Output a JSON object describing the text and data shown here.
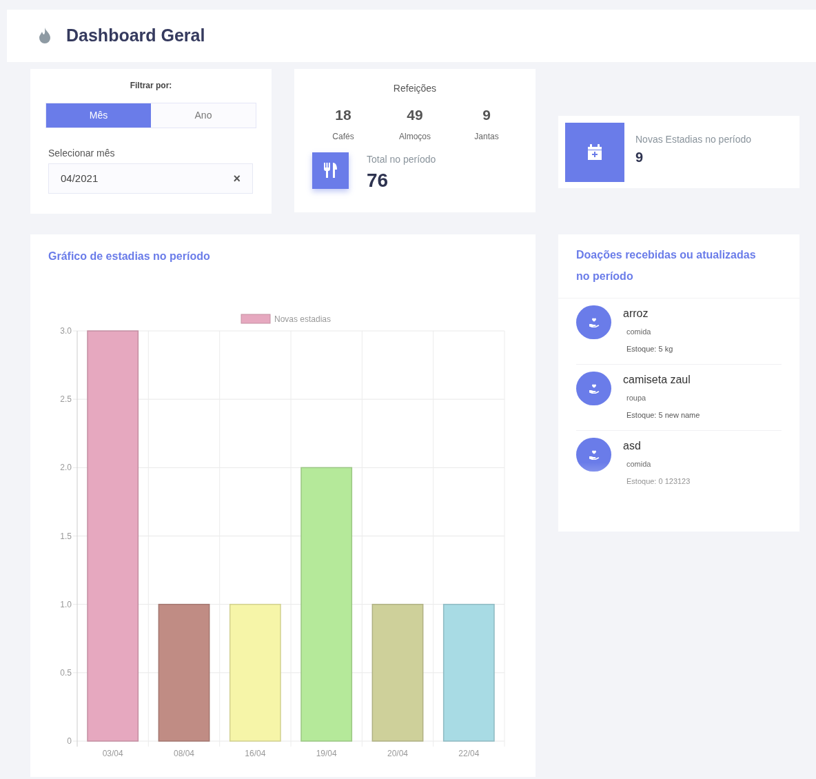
{
  "header": {
    "title": "Dashboard Geral"
  },
  "filter": {
    "label": "Filtrar por:",
    "options": [
      {
        "label": "Mês",
        "selected": true
      },
      {
        "label": "Ano",
        "selected": false
      }
    ],
    "month_label": "Selecionar mês",
    "month_value": "04/2021",
    "clear": "×"
  },
  "meals": {
    "title": "Refeições",
    "counts": [
      {
        "value": "18",
        "label": "Cafés"
      },
      {
        "value": "49",
        "label": "Almoços"
      },
      {
        "value": "9",
        "label": "Jantas"
      }
    ],
    "total_label": "Total no período",
    "total": "76"
  },
  "stays": {
    "label": "Novas Estadias no período",
    "value": "9"
  },
  "chart": {
    "title": "Gráfico de estadias no período",
    "chart_data": {
      "type": "bar",
      "categories": [
        "03/04",
        "08/04",
        "16/04",
        "19/04",
        "20/04",
        "22/04"
      ],
      "series": [
        {
          "name": "Novas estadias",
          "color": [
            "#e6a8bf",
            "#c08c84",
            "#f6f5a8",
            "#b5e99a",
            "#ced09a",
            "#a8dbe4"
          ],
          "values": [
            3,
            1,
            1,
            2,
            1,
            1
          ]
        }
      ],
      "ylim": [
        0,
        3
      ],
      "yticks": [
        {
          "value": 0,
          "label": "0"
        },
        0.5,
        {
          "value": 1,
          "label": "1.0"
        },
        1.5,
        {
          "value": 2,
          "label": "2.0"
        },
        2.5,
        {
          "value": 3,
          "label": "3.0"
        }
      ],
      "grid": true
    }
  },
  "donations": {
    "title": "Doações recebidas ou atualizadas no período",
    "items": [
      {
        "name": "arroz",
        "category": "comida",
        "stock": "Estoque: 5 kg"
      },
      {
        "name": "camiseta zaul",
        "category": "roupa",
        "stock": "Estoque: 5 new name"
      },
      {
        "name": "asd",
        "category": "comida",
        "stock": "Estoque: 0 123123"
      }
    ]
  }
}
